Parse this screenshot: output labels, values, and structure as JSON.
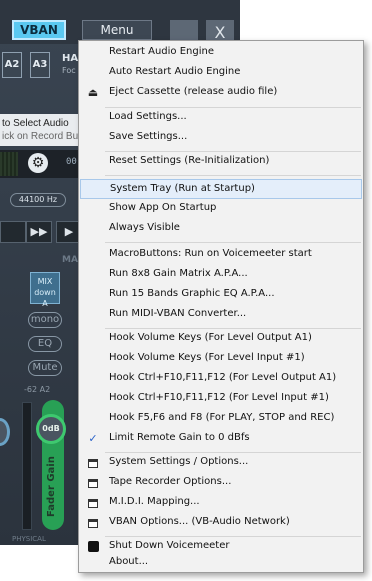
{
  "app": {
    "vban_label": "VBAN",
    "menu_label": "Menu",
    "minimize_glyph": "_",
    "close_glyph": "X",
    "bus_a2": "A2",
    "bus_a3": "A3",
    "ha_text": "HA",
    "foc_text": "Foc",
    "info_line1": "to Select Audio",
    "info_line2": "ick on Record Bu",
    "time_text": "00:",
    "sample_rate": "44100 Hz",
    "mast_label": "MAST",
    "mix_label": "MIX down A",
    "mono_label": "mono",
    "eq_label": "EQ",
    "mute_label": "Mute",
    "a2_level_label": "-62 A2",
    "fader_db": "0dB",
    "fader_gain_label": "Fader Gain",
    "physical_label": "PHYSICAL",
    "ff_glyph": "▶▶",
    "play_glyph": "▶"
  },
  "menu": {
    "items": [
      {
        "label": "Restart Audio Engine",
        "icon": ""
      },
      {
        "label": "Auto Restart Audio Engine",
        "icon": ""
      },
      {
        "label": "Eject Cassette (release audio file)",
        "icon": "eject-icon"
      },
      {
        "label": "Load Settings...",
        "icon": ""
      },
      {
        "label": "Save Settings...",
        "icon": ""
      },
      {
        "label": "Reset Settings (Re-Initialization)",
        "icon": ""
      },
      {
        "label": "System Tray (Run at Startup)",
        "icon": "",
        "highlighted": true
      },
      {
        "label": "Show App On Startup",
        "icon": ""
      },
      {
        "label": "Always Visible",
        "icon": ""
      },
      {
        "label": "MacroButtons: Run on Voicemeeter start",
        "icon": ""
      },
      {
        "label": "Run 8x8 Gain Matrix A.P.A...",
        "icon": ""
      },
      {
        "label": "Run 15 Bands Graphic EQ A.P.A...",
        "icon": ""
      },
      {
        "label": "Run MIDI-VBAN Converter...",
        "icon": ""
      },
      {
        "label": "Hook Volume Keys (For Level Output A1)",
        "icon": ""
      },
      {
        "label": "Hook Volume Keys (For Level Input #1)",
        "icon": ""
      },
      {
        "label": "Hook Ctrl+F10,F11,F12 (For Level Output A1)",
        "icon": ""
      },
      {
        "label": "Hook Ctrl+F10,F11,F12 (For Level Input #1)",
        "icon": ""
      },
      {
        "label": "Hook F5,F6 and F8 (For PLAY, STOP and REC)",
        "icon": ""
      },
      {
        "label": "Limit Remote Gain to 0 dBfs",
        "icon": "checkmark-icon",
        "checked": true
      },
      {
        "label": "System Settings / Options...",
        "icon": "window-icon"
      },
      {
        "label": "Tape Recorder Options...",
        "icon": "window-icon"
      },
      {
        "label": "M.I.D.I. Mapping...",
        "icon": "window-icon"
      },
      {
        "label": "VBAN Options... (VB-Audio Network)",
        "icon": "window-icon"
      },
      {
        "label": "Shut Down Voicemeeter",
        "icon": "power-icon"
      },
      {
        "label": "About...",
        "icon": ""
      }
    ],
    "eject_glyph": "⏏",
    "check_glyph": "✓"
  },
  "colors": {
    "highlight": "#e4eefa",
    "vban_accent": "#5ac8f0",
    "fader_green": "#28a055",
    "check_blue": "#2a63c9"
  }
}
